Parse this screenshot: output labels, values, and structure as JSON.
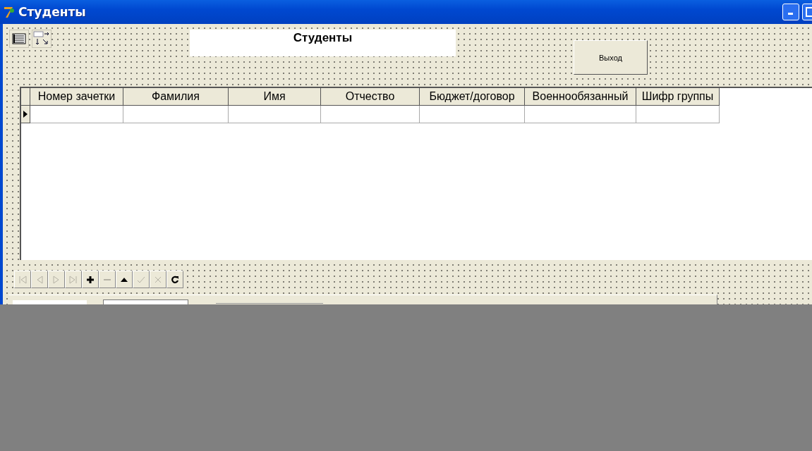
{
  "window": {
    "title": "Студенты"
  },
  "form_heading": "Студенты",
  "exit_button": "Выход",
  "table": {
    "columns": [
      "Номер зачетки",
      "Фамилия",
      "Имя",
      "Отчество",
      "Бюджет/договор",
      "Военнообязанный",
      "Шифр группы"
    ],
    "rows": [
      {
        "current": true
      }
    ]
  },
  "navigator": [
    {
      "kind": "first",
      "disabled": true
    },
    {
      "kind": "prior",
      "disabled": true
    },
    {
      "kind": "next",
      "disabled": true
    },
    {
      "kind": "last",
      "disabled": true
    },
    {
      "kind": "insert",
      "disabled": false
    },
    {
      "kind": "delete",
      "disabled": true
    },
    {
      "kind": "edit",
      "disabled": false
    },
    {
      "kind": "post",
      "disabled": true
    },
    {
      "kind": "cancel",
      "disabled": true
    },
    {
      "kind": "refresh",
      "disabled": false
    }
  ]
}
